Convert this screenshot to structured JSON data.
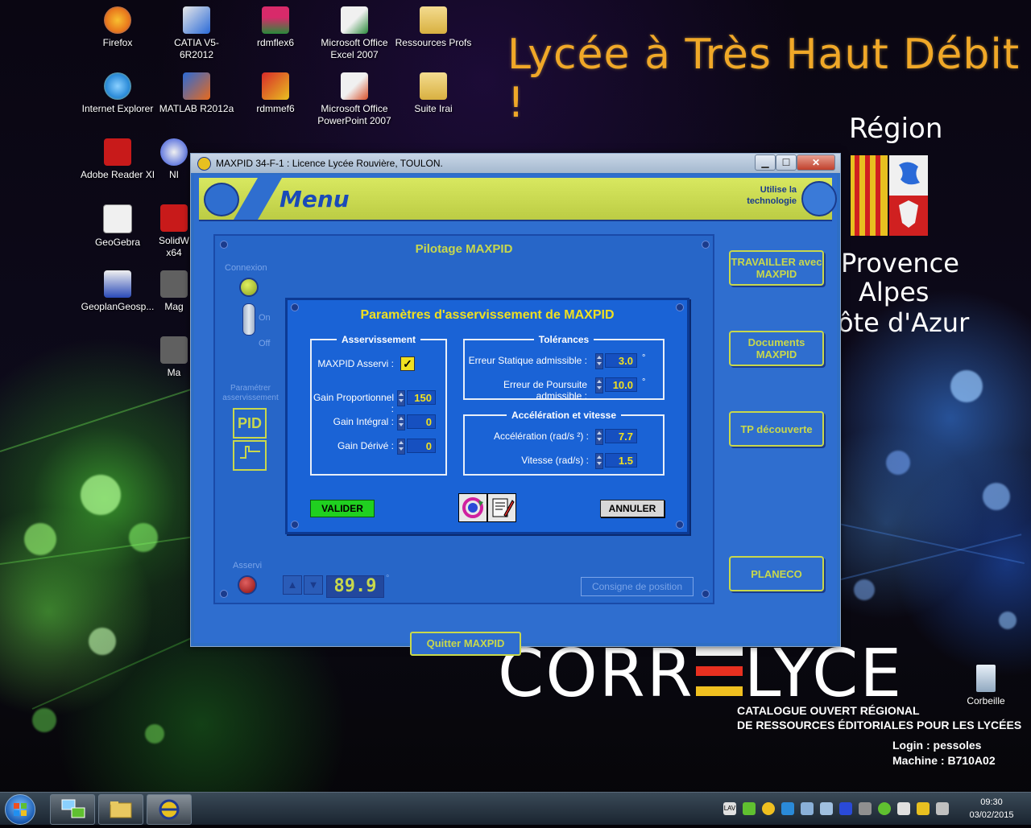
{
  "wallpaper": {
    "headline": "Lycée à Très Haut Débit !",
    "region_word": "Région",
    "region_lines": [
      "Provence",
      "Alpes",
      "ôte d'Azur"
    ],
    "correlyce_left": "CORR",
    "correlyce_right": "LYCE",
    "catalogue_line1": "CATALOGUE OUVERT RÉGIONAL",
    "catalogue_line2": "DE RESSOURCES ÉDITORIALES POUR LES LYCÉES",
    "login": "Login : pessoles",
    "machine": "Machine : B710A02"
  },
  "desktop_icons": [
    {
      "label": "Firefox",
      "icon": "firefox-icon",
      "color": "#e8761c"
    },
    {
      "label": "CATIA V5-6R2012",
      "icon": "catia-icon",
      "color": "#2a6ad8"
    },
    {
      "label": "rdmflex6",
      "icon": "rdmflex-icon",
      "color": "#d82a6a"
    },
    {
      "label": "Microsoft Office Excel 2007",
      "icon": "excel-icon",
      "color": "#2a8a3a"
    },
    {
      "label": "Ressources Profs",
      "icon": "folder-icon",
      "color": "#e8c860"
    },
    {
      "label": "Internet Explorer",
      "icon": "internet-explorer-icon",
      "color": "#2a8ad8"
    },
    {
      "label": "MATLAB R2012a",
      "icon": "matlab-icon",
      "color": "#e86a1c"
    },
    {
      "label": "rdmmef6",
      "icon": "rdmmef-icon",
      "color": "#d82a2a"
    },
    {
      "label": "Microsoft Office PowerPoint 2007",
      "icon": "powerpoint-icon",
      "color": "#d8502a"
    },
    {
      "label": "Suite Irai",
      "icon": "folder-icon",
      "color": "#e8c860"
    },
    {
      "label": "Adobe Reader XI",
      "icon": "adobe-reader-icon",
      "color": "#c81a1a"
    },
    {
      "label": "NI",
      "icon": "ni-icon",
      "color": "#2a4ad8"
    },
    {
      "label": "GeoGebra",
      "icon": "geogebra-icon",
      "color": "#e8e8e8"
    },
    {
      "label": "SolidW x64",
      "icon": "solidworks-icon",
      "color": "#c81a1a"
    },
    {
      "label": "GeoplanGeosp...",
      "icon": "geoplan-icon",
      "color": "#e8e8e8"
    },
    {
      "label": "Mag",
      "icon": "mag-icon",
      "color": "#a0a0a0"
    },
    {
      "label": "Ma",
      "icon": "ma-icon",
      "color": "#a0a0a0"
    },
    {
      "label": "Corbeille",
      "icon": "recycle-bin-icon",
      "color": "#c8d8e8"
    }
  ],
  "window": {
    "title": "MAXPID 34-F-1 : Licence Lycée Rouvière, TOULON.",
    "minimize": "▁",
    "maximize": "☐",
    "close": "✕"
  },
  "app": {
    "menu_title": "Menu",
    "uses_technology": "Utilise la technologie",
    "pilot_title": "Pilotage MAXPID",
    "connexion": "Connexion",
    "on": "On",
    "off": "Off",
    "parametrer": "Paramétrer asservissement",
    "pid": "PID",
    "asservi": "Asservi",
    "position_value": "89.9",
    "degree": "°",
    "consigne": "Consigne de position",
    "quit": "Quitter MAXPID",
    "side_buttons": [
      "TRAVAILLER avec MAXPID",
      "Documents MAXPID",
      "TP découverte",
      "PLANECO"
    ]
  },
  "dialog": {
    "title": "Paramètres d'asservissement de MAXPID",
    "asservissement": {
      "title": "Asservissement",
      "maxpid_asservi_label": "MAXPID Asservi :",
      "maxpid_asservi_checked": true,
      "check_mark": "✓",
      "gain_p_label": "Gain Proportionnel :",
      "gain_p": "150",
      "gain_i_label": "Gain Intégral :",
      "gain_i": "0",
      "gain_d_label": "Gain Dérivé :",
      "gain_d": "0"
    },
    "tolerances": {
      "title": "Tolérances",
      "static_label": "Erreur Statique admissible :",
      "static_value": "3.0",
      "static_unit": "°",
      "pursuit_label": "Erreur de Poursuite admissible :",
      "pursuit_value": "10.0",
      "pursuit_unit": "°"
    },
    "acceleration": {
      "title": "Accélération et vitesse",
      "accel_label": "Accélération (rad/s ²) :",
      "accel_value": "7.7",
      "speed_label": "Vitesse (rad/s) :",
      "speed_value": "1.5"
    },
    "validate": "VALIDER",
    "cancel": "ANNULER"
  },
  "taskbar": {
    "time": "09:30",
    "date": "03/02/2015",
    "tray_language": "LAV"
  },
  "colors": {
    "app_blue": "#2f6ecf",
    "app_yellow": "#c8d84c",
    "dialog_blue": "#1a63d6",
    "value_yellow": "#f0e020",
    "valider_green": "#20d020",
    "headline_orange": "#f0a828"
  }
}
